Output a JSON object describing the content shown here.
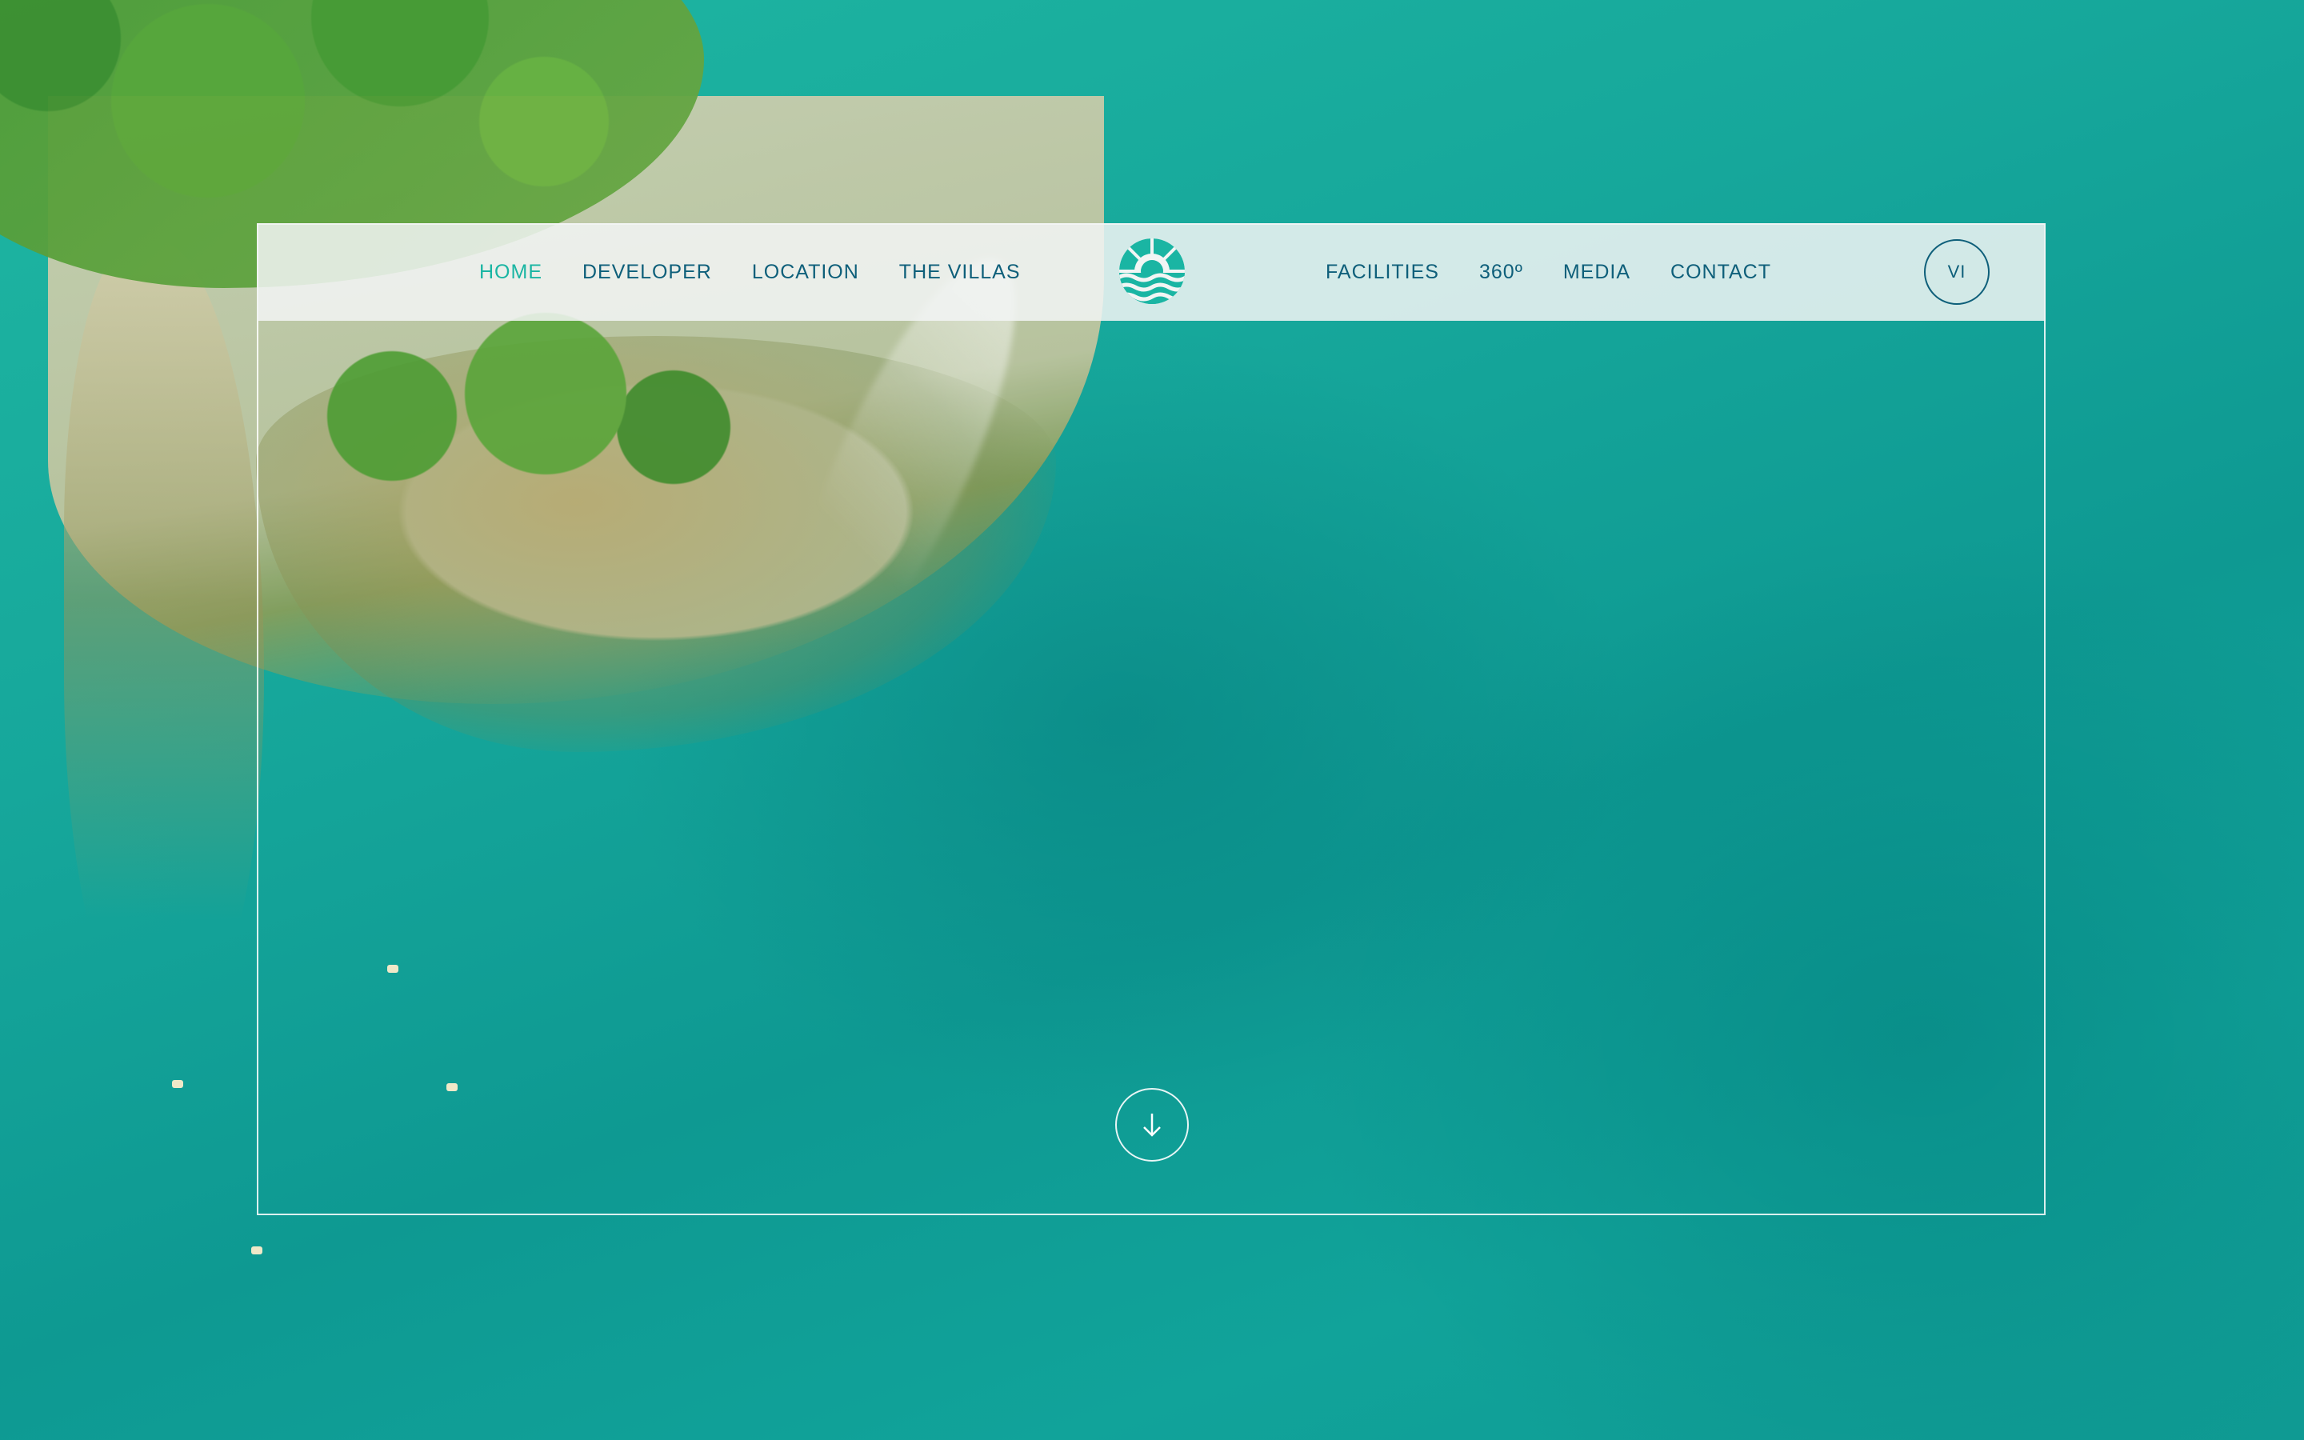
{
  "nav": {
    "left": [
      {
        "label": "HOME",
        "active": true
      },
      {
        "label": "DEVELOPER"
      },
      {
        "label": "LOCATION"
      },
      {
        "label": "THE VILLAS"
      }
    ],
    "right": [
      {
        "label": "FACILITIES"
      },
      {
        "label": "360º"
      },
      {
        "label": "MEDIA"
      },
      {
        "label": "CONTACT"
      }
    ],
    "language": "VI"
  },
  "colors": {
    "accent": "#1ab5a3",
    "nav_text": "#0e5f7a",
    "nav_background": "#f2f5f4"
  },
  "icons": {
    "logo": "sun-over-waves-logo",
    "scroll": "arrow-down-icon"
  }
}
